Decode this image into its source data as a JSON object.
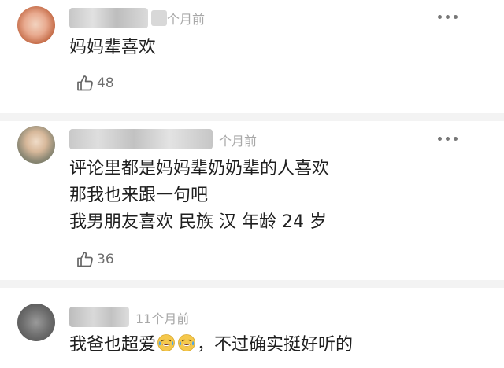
{
  "comments": [
    {
      "username": "",
      "time": "个月前",
      "text_lines": [
        "妈妈辈喜欢"
      ],
      "likes": "48"
    },
    {
      "username": "",
      "time": "个月前",
      "text_lines": [
        "评论里都是妈妈辈奶奶辈的人喜欢",
        "那我也来跟一句吧",
        "我男朋友喜欢 民族 汉 年龄 24 岁"
      ],
      "likes": "36"
    },
    {
      "username": "",
      "time": "11个月前",
      "text_before": "我爸也超爱",
      "emoji": [
        "laughing-tears-emoji",
        "laughing-tears-emoji"
      ],
      "text_after": "，不过确实挺好听的"
    }
  ],
  "colors": {
    "time_gray": "#a8a8a8",
    "count_gray": "#6d6d6d",
    "divider": "#f3f3f3",
    "emoji_face": "#f5c84c",
    "emoji_tear": "#4aa3e8"
  }
}
